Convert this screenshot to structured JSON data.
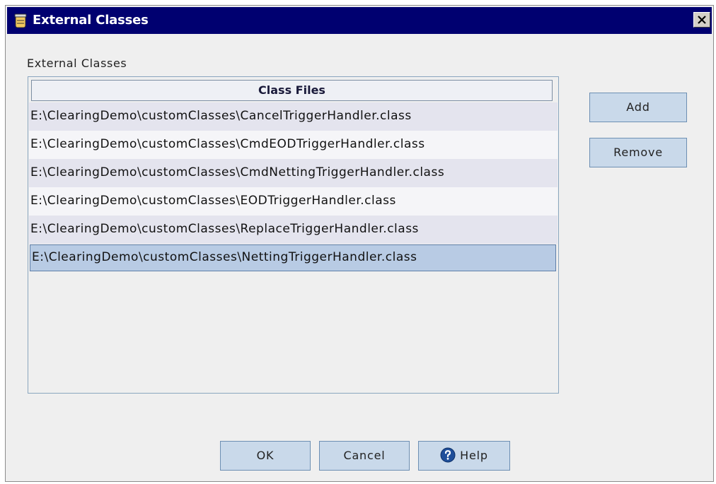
{
  "window": {
    "title": "External Classes"
  },
  "group": {
    "label": "External Classes"
  },
  "list": {
    "header": "Class Files",
    "rows": [
      {
        "path": "E:\\ClearingDemo\\customClasses\\CancelTriggerHandler.class",
        "selected": false
      },
      {
        "path": "E:\\ClearingDemo\\customClasses\\CmdEODTriggerHandler.class",
        "selected": false
      },
      {
        "path": "E:\\ClearingDemo\\customClasses\\CmdNettingTriggerHandler.class",
        "selected": false
      },
      {
        "path": "E:\\ClearingDemo\\customClasses\\EODTriggerHandler.class",
        "selected": false
      },
      {
        "path": "E:\\ClearingDemo\\customClasses\\ReplaceTriggerHandler.class",
        "selected": false
      },
      {
        "path": "E:\\ClearingDemo\\customClasses\\NettingTriggerHandler.class",
        "selected": true
      }
    ]
  },
  "side_buttons": {
    "add": "Add",
    "remove": "Remove"
  },
  "footer_buttons": {
    "ok": "OK",
    "cancel": "Cancel",
    "help": "Help"
  },
  "icons": {
    "title": "jar-icon",
    "close": "close-icon",
    "help": "help-icon"
  },
  "colors": {
    "titlebar": "#000070",
    "selection": "#b8cbe4",
    "button": "#c9d9ea"
  }
}
